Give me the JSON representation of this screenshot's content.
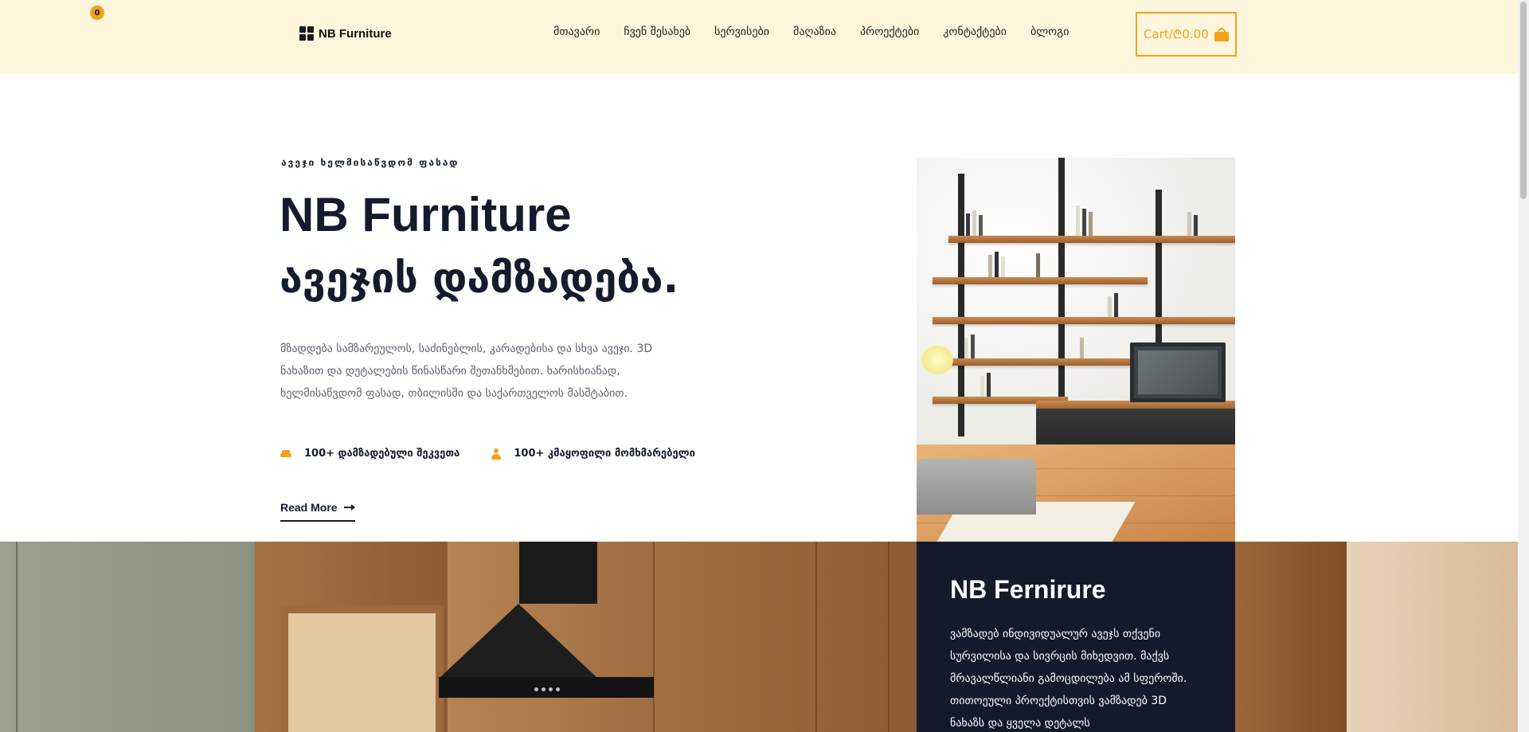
{
  "header": {
    "brand": "NB Furniture",
    "nav": [
      "მთავარი",
      "ჩვენ შესახებ",
      "სერვისები",
      "მაღაზია",
      "პროექტები",
      "კონტაქტები",
      "ბლოგი"
    ],
    "cart_label": "Cart/₾0.00",
    "cart_count": "0"
  },
  "hero": {
    "eyebrow": "ავეჯი ხელმისაწვდომ ფასად",
    "title_line1": "NB Furniture",
    "title_line2": "ავეჯის დამზადება.",
    "description": "მზადდება სამზარეულოს, საძინებლის, კარადებისა და სხვა ავეჯი. 3D ნახაზით და დეტალების წინასწარი შეთანხმებით. ხარისხიანად, ხელმისაწვდომ ფასად, თბილისში და საქართველოს მასშტაბით.",
    "stats": [
      {
        "icon": "sofa-icon",
        "label": "100+ დამზადებული შეკვეთა"
      },
      {
        "icon": "user-icon",
        "label": "100+ კმაყოფილი მომხმარებელი"
      }
    ],
    "read_more": "Read More"
  },
  "card": {
    "title": "NB Fernirure",
    "text": "ვამზადებ ინდივიდუალურ ავეჯს თქვენი სურვილისა და სივრცის მიხედვით. მაქვს მრავალწლიანი გამოცდილება ამ სფეროში. თითოეული პროექტისთვის ვამზადებ 3D ნახაზს და ყველა დეტალს"
  },
  "colors": {
    "accent": "#f2a119",
    "header_bg": "#fdf6dc",
    "dark": "#121a2c"
  }
}
